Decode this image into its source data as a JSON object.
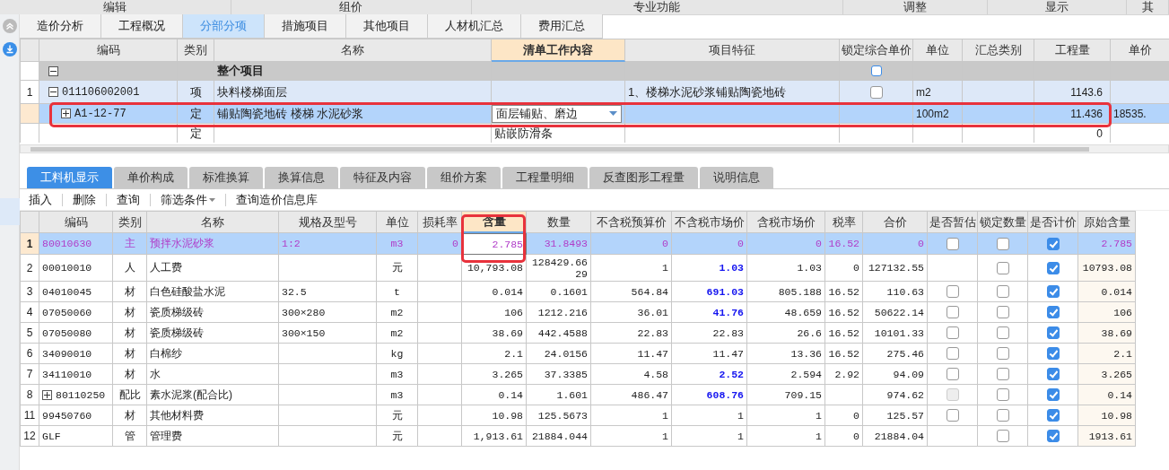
{
  "ribbon_groups": [
    {
      "label": "编辑"
    },
    {
      "label": "组价"
    },
    {
      "label": "专业功能"
    },
    {
      "label": "调整"
    },
    {
      "label": "显示"
    },
    {
      "label": "其"
    }
  ],
  "main_tabs": [
    {
      "label": "造价分析",
      "selected": false
    },
    {
      "label": "工程概况",
      "selected": false
    },
    {
      "label": "分部分项",
      "selected": true
    },
    {
      "label": "措施项目",
      "selected": false
    },
    {
      "label": "其他项目",
      "selected": false
    },
    {
      "label": "人材机汇总",
      "selected": false
    },
    {
      "label": "费用汇总",
      "selected": false
    }
  ],
  "item_table": {
    "columns": [
      {
        "label": "编码",
        "active": false
      },
      {
        "label": "类别",
        "active": false
      },
      {
        "label": "名称",
        "active": false
      },
      {
        "label": "清单工作内容",
        "active": true
      },
      {
        "label": "项目特征",
        "active": false
      },
      {
        "label": "锁定综合单价",
        "active": false
      },
      {
        "label": "单位",
        "active": false
      },
      {
        "label": "汇总类别",
        "active": false
      },
      {
        "label": "工程量",
        "active": false
      },
      {
        "label": "单价",
        "active": false
      }
    ],
    "rows": [
      {
        "kind": "total",
        "expanded": true,
        "name": "整个项目",
        "lock_price": false,
        "selected": false
      },
      {
        "kind": "list",
        "no": "1",
        "expanded": true,
        "code": "011106002001",
        "type": "项",
        "name": "块料楼梯面层",
        "feature": "1、楼梯水泥砂浆铺贴陶瓷地砖",
        "lock_price": false,
        "unit": "m2",
        "quantity": "1143.6",
        "selected": false
      },
      {
        "kind": "quota",
        "expanded": false,
        "code": "A1-12-77",
        "type": "定",
        "name": "铺贴陶瓷地砖 楼梯 水泥砂浆",
        "work": "面层铺贴、磨边",
        "unit": "100m2",
        "quantity": "11.436",
        "price": "18535.",
        "selected": true
      },
      {
        "kind": "quota",
        "type": "定",
        "work": "贴嵌防滑条",
        "quantity": "0",
        "selected": false
      }
    ]
  },
  "detail_tabs": [
    {
      "label": "工料机显示",
      "selected": true
    },
    {
      "label": "单价构成",
      "selected": false
    },
    {
      "label": "标准换算",
      "selected": false
    },
    {
      "label": "换算信息",
      "selected": false
    },
    {
      "label": "特征及内容",
      "selected": false
    },
    {
      "label": "组价方案",
      "selected": false
    },
    {
      "label": "工程量明细",
      "selected": false
    },
    {
      "label": "反查图形工程量",
      "selected": false
    },
    {
      "label": "说明信息",
      "selected": false
    }
  ],
  "toolbar": [
    {
      "label": "插入",
      "kind": "button"
    },
    {
      "label": "删除",
      "kind": "button"
    },
    {
      "label": "查询",
      "kind": "button"
    },
    {
      "label": "筛选条件",
      "kind": "menu"
    },
    {
      "label": "查询造价信息库",
      "kind": "button"
    }
  ],
  "resource_table": {
    "columns": [
      {
        "label": "编码",
        "active": false
      },
      {
        "label": "类别",
        "active": false
      },
      {
        "label": "名称",
        "active": false
      },
      {
        "label": "规格及型号",
        "active": false
      },
      {
        "label": "单位",
        "active": false
      },
      {
        "label": "损耗率",
        "active": false
      },
      {
        "label": "含量",
        "active": true
      },
      {
        "label": "数量",
        "active": false
      },
      {
        "label": "不含税预算价",
        "active": false
      },
      {
        "label": "不含税市场价",
        "active": false
      },
      {
        "label": "含税市场价",
        "active": false
      },
      {
        "label": "税率",
        "active": false
      },
      {
        "label": "合价",
        "active": false
      },
      {
        "label": "是否暂估",
        "active": false
      },
      {
        "label": "锁定数量",
        "active": false
      },
      {
        "label": "是否计价",
        "active": false
      },
      {
        "label": "原始含量",
        "active": false
      }
    ],
    "rows": [
      {
        "no": "1",
        "kind": "main",
        "code": "80010630",
        "type": "主",
        "name": "预拌水泥砂浆",
        "spec": "1:2",
        "unit": "m3",
        "loss": "0",
        "content": "2.785",
        "quantity": "31.8493",
        "budget_price": "0",
        "market_price": "0",
        "market_adjusted": false,
        "tax_price": "0",
        "tax_rate": "16.52",
        "total": "0",
        "estimated": false,
        "locked": false,
        "priced": true,
        "original": "2.785",
        "selected": true
      },
      {
        "no": "2",
        "kind": "normal",
        "code": "00010010",
        "type": "人",
        "name": "人工费",
        "unit": "元",
        "content": "10,793.08",
        "quantity": "128429.6629",
        "budget_price": "1",
        "market_price": "1.03",
        "market_adjusted": true,
        "tax_price": "1.03",
        "tax_rate": "0",
        "total": "127132.55",
        "locked": false,
        "priced": true,
        "original": "10793.08",
        "selected": false
      },
      {
        "no": "3",
        "kind": "normal",
        "code": "04010045",
        "type": "材",
        "name": "白色硅酸盐水泥",
        "spec": "32.5",
        "unit": "t",
        "content": "0.014",
        "quantity": "0.1601",
        "budget_price": "564.84",
        "market_price": "691.03",
        "market_adjusted": true,
        "tax_price": "805.188",
        "tax_rate": "16.52",
        "total": "110.63",
        "estimated": false,
        "locked": false,
        "priced": true,
        "original": "0.014",
        "selected": false
      },
      {
        "no": "4",
        "kind": "normal",
        "code": "07050060",
        "type": "材",
        "name": "瓷质梯级砖",
        "spec": "300×280",
        "unit": "m2",
        "content": "106",
        "quantity": "1212.216",
        "budget_price": "36.01",
        "market_price": "41.76",
        "market_adjusted": true,
        "tax_price": "48.659",
        "tax_rate": "16.52",
        "total": "50622.14",
        "estimated": false,
        "locked": false,
        "priced": true,
        "original": "106",
        "selected": false
      },
      {
        "no": "5",
        "kind": "normal",
        "code": "07050080",
        "type": "材",
        "name": "瓷质梯级砖",
        "spec": "300×150",
        "unit": "m2",
        "content": "38.69",
        "quantity": "442.4588",
        "budget_price": "22.83",
        "market_price": "22.83",
        "market_adjusted": false,
        "tax_price": "26.6",
        "tax_rate": "16.52",
        "total": "10101.33",
        "estimated": false,
        "locked": false,
        "priced": true,
        "original": "38.69",
        "selected": false
      },
      {
        "no": "6",
        "kind": "normal",
        "code": "34090010",
        "type": "材",
        "name": "白棉纱",
        "unit": "kg",
        "content": "2.1",
        "quantity": "24.0156",
        "budget_price": "11.47",
        "market_price": "11.47",
        "market_adjusted": false,
        "tax_price": "13.36",
        "tax_rate": "16.52",
        "total": "275.46",
        "estimated": false,
        "locked": false,
        "priced": true,
        "original": "2.1",
        "selected": false
      },
      {
        "no": "7",
        "kind": "normal",
        "code": "34110010",
        "type": "材",
        "name": "水",
        "unit": "m3",
        "content": "3.265",
        "quantity": "37.3385",
        "budget_price": "4.58",
        "market_price": "2.52",
        "market_adjusted": true,
        "tax_price": "2.594",
        "tax_rate": "2.92",
        "total": "94.09",
        "estimated": false,
        "locked": false,
        "priced": true,
        "original": "3.265",
        "selected": false
      },
      {
        "no": "8",
        "kind": "normal",
        "expandable": true,
        "code": "80110250",
        "type": "配比",
        "name": "素水泥浆(配合比)",
        "unit": "m3",
        "content": "0.14",
        "quantity": "1.601",
        "budget_price": "486.47",
        "market_price": "608.76",
        "market_adjusted": true,
        "tax_price": "709.15",
        "total": "974.62",
        "estimated": false,
        "estimate_disabled": true,
        "locked": false,
        "priced": true,
        "original": "0.14",
        "selected": false
      },
      {
        "no": "11",
        "kind": "normal",
        "code": "99450760",
        "type": "材",
        "name": "其他材料费",
        "unit": "元",
        "content": "10.98",
        "quantity": "125.5673",
        "budget_price": "1",
        "market_price": "1",
        "market_adjusted": false,
        "tax_price": "1",
        "tax_rate": "0",
        "total": "125.57",
        "estimated": false,
        "locked": false,
        "priced": true,
        "original": "10.98",
        "selected": false
      },
      {
        "no": "12",
        "kind": "normal",
        "code": "GLF",
        "type": "管",
        "name": "管理费",
        "unit": "元",
        "content": "1,913.61",
        "quantity": "21884.044",
        "budget_price": "1",
        "market_price": "1",
        "market_adjusted": false,
        "tax_price": "1",
        "tax_rate": "0",
        "total": "21884.04",
        "locked": false,
        "priced": true,
        "original": "1913.61",
        "selected": false
      }
    ]
  }
}
